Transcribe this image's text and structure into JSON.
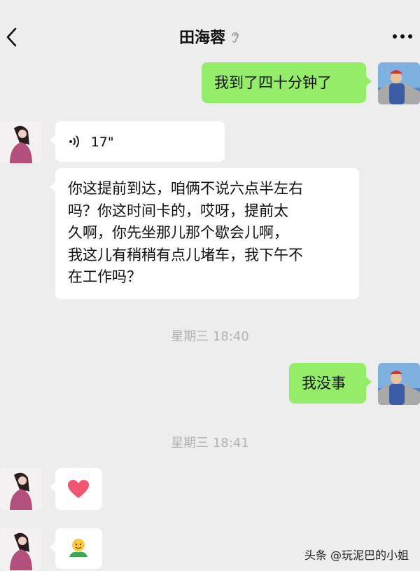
{
  "header": {
    "title": "田海蓉",
    "back_icon": "back-chevron-icon",
    "more_icon": "more-dots-icon",
    "status_icon": "ear-icon"
  },
  "messages": [
    {
      "side": "right",
      "type": "text",
      "text": "我到了四十分钟了"
    },
    {
      "side": "left",
      "type": "voice",
      "duration": "17\""
    },
    {
      "side": "left",
      "type": "text",
      "lines": [
        "你这提前到达，咱俩不说六点半左右",
        "吗？你这时间卡的，哎呀，提前太",
        "久啊，你先坐那儿那个歇会儿啊，",
        "我这儿有稍稍有点儿堵车，我下午不",
        "在工作吗？"
      ]
    },
    {
      "type": "timestamp",
      "text": "星期三 18:40"
    },
    {
      "side": "right",
      "type": "text",
      "text": "我没事"
    },
    {
      "type": "timestamp",
      "text": "星期三 18:41"
    },
    {
      "side": "left",
      "type": "emoji",
      "emoji": "heart-icon"
    },
    {
      "side": "left",
      "type": "emoji",
      "emoji": "hug-emoji-icon"
    }
  ],
  "watermark": "头条 @玩泥巴的小姐",
  "colors": {
    "background": "#ededed",
    "sent_bubble": "#95ec69",
    "received_bubble": "#ffffff",
    "timestamp": "#b2b2b2"
  }
}
